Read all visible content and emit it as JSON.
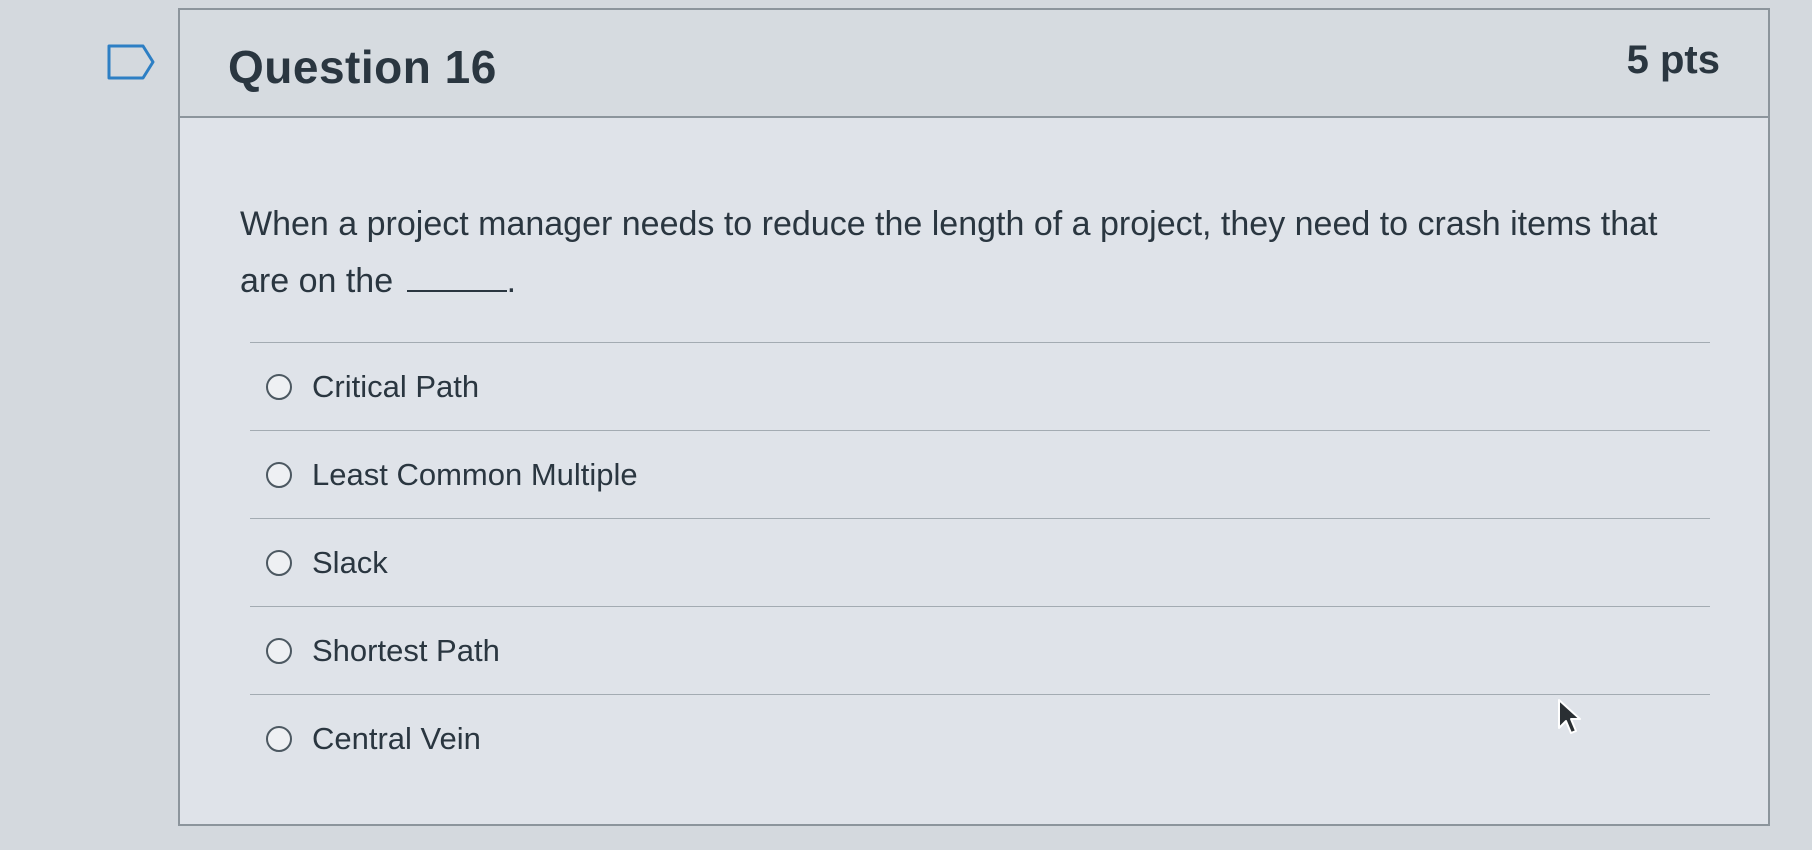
{
  "icons": {
    "bookmark": "flag-bookmark-icon",
    "cursor": "mouse-pointer-icon",
    "radio": "radio-unselected-icon"
  },
  "question": {
    "title": "Question 16",
    "points": "5 pts",
    "text": "When a project manager needs to reduce the length of a project, they need to crash items that are on the",
    "text_end": ".",
    "answers": [
      {
        "label": "Critical Path",
        "selected": false
      },
      {
        "label": "Least Common Multiple",
        "selected": false
      },
      {
        "label": "Slack",
        "selected": false
      },
      {
        "label": "Shortest Path",
        "selected": false
      },
      {
        "label": "Central Vein",
        "selected": false
      }
    ]
  },
  "colors": {
    "background": "#d4d9de",
    "card": "#dfe3e9",
    "header": "#d6dbe0",
    "text": "#2a3640",
    "border": "#8c959c"
  }
}
